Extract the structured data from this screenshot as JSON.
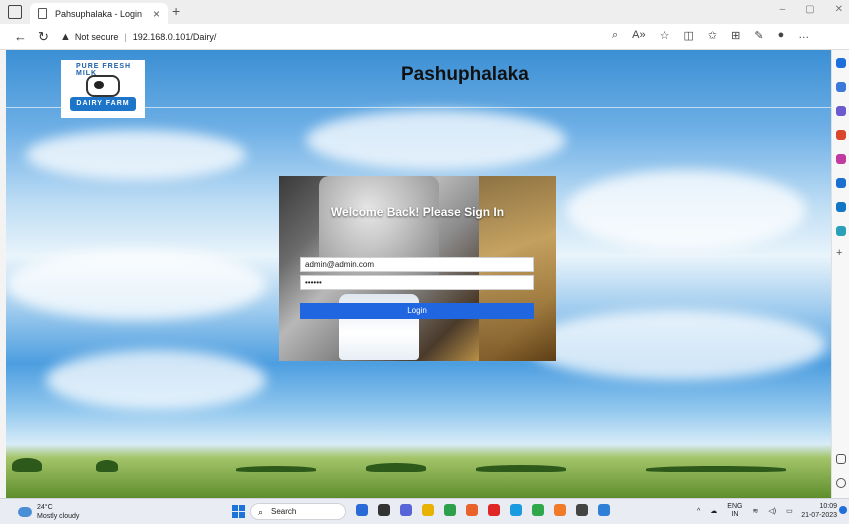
{
  "browser": {
    "tab_title": "Pahsuphalaka - Login",
    "tab_close": "×",
    "new_tab": "+",
    "security_label": "Not secure",
    "url": "192.168.0.101/Dairy/",
    "window_controls": [
      "–",
      "▢",
      "✕"
    ]
  },
  "page": {
    "site_title": "Pashuphalaka",
    "logo_top_text": "PURE FRESH MILK",
    "logo_ribbon_text": "DAIRY FARM",
    "login": {
      "title": "Welcome Back! Please Sign In",
      "email_value": "admin@admin.com",
      "password_value": "••••••",
      "button_label": "Login"
    }
  },
  "taskbar": {
    "weather_temp": "24°C",
    "weather_desc": "Mostly cloudy",
    "search_label": "Search",
    "lang_top": "ENG",
    "lang_bottom": "IN",
    "time": "10:09",
    "date": "21-07-2023"
  },
  "colors": {
    "login_button": "#1f66e0",
    "edge_blue": "#1d6fdc"
  }
}
